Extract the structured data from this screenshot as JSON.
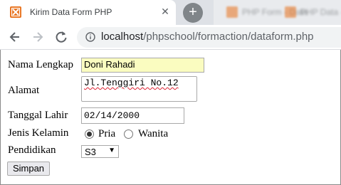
{
  "browser": {
    "tab_title": "Kirim Data Form PHP",
    "url_host": "localhost",
    "url_path": "/phpschool/formaction/dataform.php",
    "blurred_tab_1": "PHP Form - Data",
    "blurred_tab_2": "PHP Data - Data",
    "colors": {
      "tabstrip": "#dee1e6",
      "favicon": "#e8711c",
      "omnibox": "#f1f3f4"
    }
  },
  "form": {
    "nama_label": "Nama Lengkap",
    "nama_value": "Doni Rahadi",
    "alamat_label": "Alamat",
    "alamat_value": "Jl.Tenggiri No.12",
    "tanggal_label": "Tanggal Lahir",
    "tanggal_value": "02/14/2000",
    "jenis_label": "Jenis Kelamin",
    "gender_options": [
      {
        "label": "Pria",
        "checked": true
      },
      {
        "label": "Wanita",
        "checked": false
      }
    ],
    "pendidikan_label": "Pendidikan",
    "pendidikan_value": "S3",
    "submit_label": "Simpan",
    "colors": {
      "autofill_bg": "#fafcc0"
    }
  }
}
